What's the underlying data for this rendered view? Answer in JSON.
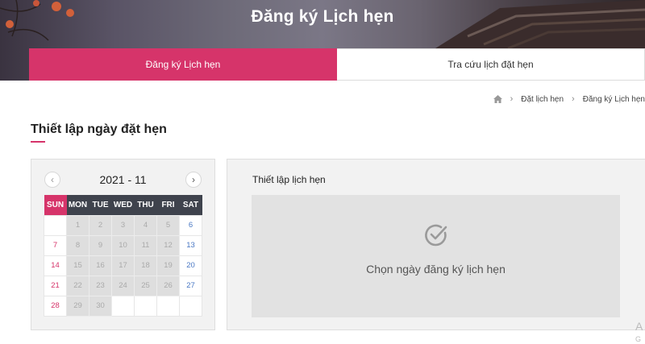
{
  "header": {
    "title": "Đăng ký Lịch hẹn"
  },
  "tabs": [
    {
      "label": "Đăng ký Lịch hẹn",
      "active": true
    },
    {
      "label": "Tra cứu lịch đặt hẹn",
      "active": false
    }
  ],
  "breadcrumb": {
    "icon": "home-icon",
    "items": [
      "Đặt lịch hẹn",
      "Đăng ký Lịch hẹn"
    ]
  },
  "section": {
    "title": "Thiết lập ngày đặt hẹn"
  },
  "calendar": {
    "month_label": "2021 - 11",
    "weekdays": [
      "SUN",
      "MON",
      "TUE",
      "WED",
      "THU",
      "FRI",
      "SAT"
    ],
    "weeks": [
      [
        "",
        "1",
        "2",
        "3",
        "4",
        "5",
        "6"
      ],
      [
        "7",
        "8",
        "9",
        "10",
        "11",
        "12",
        "13"
      ],
      [
        "14",
        "15",
        "16",
        "17",
        "18",
        "19",
        "20"
      ],
      [
        "21",
        "22",
        "23",
        "24",
        "25",
        "26",
        "27"
      ],
      [
        "28",
        "29",
        "30",
        "",
        "",
        "",
        ""
      ]
    ],
    "disabled": [
      [
        false,
        true,
        true,
        true,
        true,
        true,
        false
      ],
      [
        false,
        true,
        true,
        true,
        true,
        true,
        false
      ],
      [
        false,
        true,
        true,
        true,
        true,
        true,
        false
      ],
      [
        false,
        true,
        true,
        true,
        true,
        true,
        false
      ],
      [
        false,
        true,
        true,
        false,
        false,
        false,
        false
      ]
    ]
  },
  "panel": {
    "title": "Thiết lập lịch hẹn",
    "message": "Chọn ngày đăng ký lịch hẹn",
    "icon": "check-circle-icon"
  },
  "edge": {
    "text1": "A",
    "text2": "G"
  },
  "colors": {
    "accent": "#d6346a",
    "weekday_header": "#3f434d",
    "saturday": "#4a78c4"
  }
}
